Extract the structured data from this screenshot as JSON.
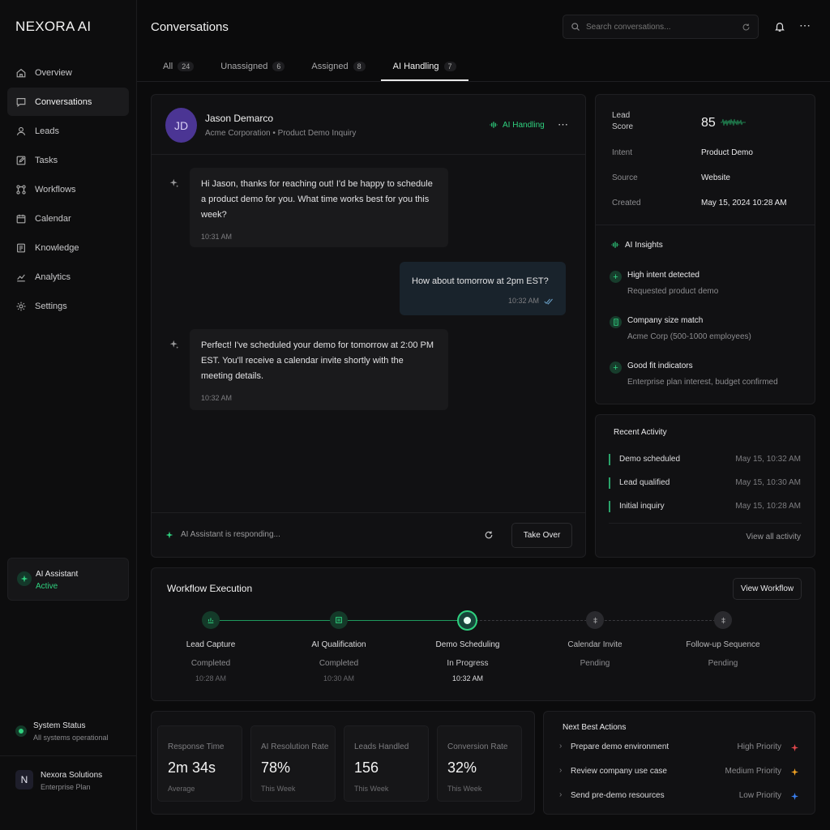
{
  "app": {
    "name": "NEXORA AI"
  },
  "sidebar": {
    "items": [
      {
        "label": "Overview",
        "icon": "home-icon"
      },
      {
        "label": "Conversations",
        "icon": "chat-icon"
      },
      {
        "label": "Leads",
        "icon": "user-icon"
      },
      {
        "label": "Tasks",
        "icon": "edit-icon"
      },
      {
        "label": "Workflows",
        "icon": "workflow-icon"
      },
      {
        "label": "Calendar",
        "icon": "calendar-icon"
      },
      {
        "label": "Knowledge",
        "icon": "book-icon"
      },
      {
        "label": "Analytics",
        "icon": "analytics-icon"
      },
      {
        "label": "Settings",
        "icon": "gear-icon"
      }
    ],
    "active_index": 1,
    "ai_assistant": {
      "title": "AI Assistant",
      "status": "Active"
    },
    "system_status": {
      "title": "System Status",
      "detail": "All systems operational"
    },
    "org": {
      "initial": "N",
      "name": "Nexora Solutions",
      "plan": "Enterprise Plan"
    }
  },
  "header": {
    "title": "Conversations",
    "search_placeholder": "Search conversations..."
  },
  "tabs": [
    {
      "label": "All",
      "count": "24"
    },
    {
      "label": "Unassigned",
      "count": "6"
    },
    {
      "label": "Assigned",
      "count": "8"
    },
    {
      "label": "AI Handling",
      "count": "7"
    }
  ],
  "conversation": {
    "contact": {
      "initials": "JD",
      "name": "Jason Demarco",
      "subtitle": "Acme Corporation • Product Demo Inquiry"
    },
    "status": "AI Handling",
    "messages": [
      {
        "from": "ai",
        "text": "Hi Jason, thanks for reaching out! I'd be happy to schedule a product demo for you. What time works best for you this week?",
        "time": "10:31 AM"
      },
      {
        "from": "user",
        "text": "How about tomorrow at 2pm EST?",
        "time": "10:32 AM"
      },
      {
        "from": "ai",
        "text": "Perfect! I've scheduled your demo for tomorrow at 2:00 PM EST. You'll receive a calendar invite shortly with the meeting details.",
        "time": "10:32 AM"
      }
    ],
    "footer_status": "AI Assistant is responding...",
    "take_over_label": "Take Over"
  },
  "lead": {
    "score_label": "Lead Score",
    "score": "85",
    "fields": [
      {
        "label": "Intent",
        "value": "Product Demo"
      },
      {
        "label": "Source",
        "value": "Website"
      },
      {
        "label": "Created",
        "value": "May 15, 2024 10:28 AM"
      }
    ]
  },
  "insights": {
    "title": "AI Insights",
    "items": [
      {
        "title": "High intent detected",
        "detail": "Requested product demo"
      },
      {
        "title": "Company size match",
        "detail": "Acme Corp (500-1000 employees)"
      },
      {
        "title": "Good fit indicators",
        "detail": "Enterprise plan interest, budget confirmed"
      }
    ]
  },
  "activity": {
    "title": "Recent Activity",
    "items": [
      {
        "label": "Demo scheduled",
        "time": "May 15, 10:32 AM"
      },
      {
        "label": "Lead qualified",
        "time": "May 15, 10:30 AM"
      },
      {
        "label": "Initial inquiry",
        "time": "May 15, 10:28 AM"
      }
    ],
    "view_all": "View all activity"
  },
  "workflow": {
    "title": "Workflow Execution",
    "button": "View Workflow",
    "steps": [
      {
        "name": "Lead Capture",
        "status": "Completed",
        "time": "10:28 AM",
        "state": "done"
      },
      {
        "name": "AI Qualification",
        "status": "Completed",
        "time": "10:30 AM",
        "state": "done"
      },
      {
        "name": "Demo Scheduling",
        "status": "In Progress",
        "time": "10:32 AM",
        "state": "active"
      },
      {
        "name": "Calendar Invite",
        "status": "Pending",
        "time": "",
        "state": "pending"
      },
      {
        "name": "Follow-up Sequence",
        "status": "Pending",
        "time": "",
        "state": "pending"
      }
    ]
  },
  "stats": [
    {
      "label": "Response Time",
      "value": "2m 34s",
      "sub": "Average"
    },
    {
      "label": "AI Resolution Rate",
      "value": "78%",
      "sub": "This Week"
    },
    {
      "label": "Leads Handled",
      "value": "156",
      "sub": "This Week"
    },
    {
      "label": "Conversion Rate",
      "value": "32%",
      "sub": "This Week"
    }
  ],
  "next_actions": {
    "title": "Next Best Actions",
    "items": [
      {
        "label": "Prepare demo environment",
        "priority": "High Priority",
        "color": "#e5484d"
      },
      {
        "label": "Review company use case",
        "priority": "Medium Priority",
        "color": "#f5a524"
      },
      {
        "label": "Send pre-demo resources",
        "priority": "Low Priority",
        "color": "#3b82f6"
      }
    ]
  },
  "colors": {
    "accent_green": "#2fd17f",
    "avatar_purple": "#4b3594"
  }
}
